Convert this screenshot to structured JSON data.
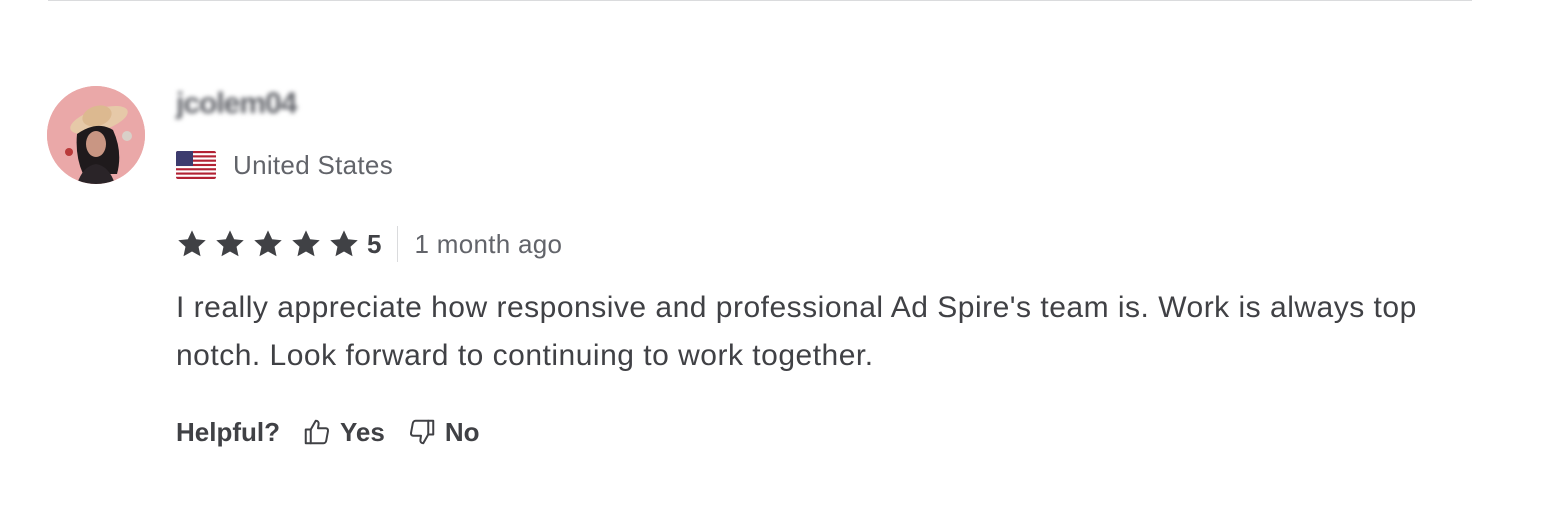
{
  "review": {
    "username": "jcolem04",
    "country": "United States",
    "country_flag_icon": "us-flag-icon",
    "rating": {
      "value": 5,
      "value_label": "5",
      "max": 5,
      "star_icon": "star-icon",
      "star_color": "#404145"
    },
    "time_ago": "1 month ago",
    "text": "I really appreciate how responsive and professional Ad Spire's team is. Work is always top notch. Look forward to continuing to work together.",
    "helpful": {
      "label": "Helpful?",
      "yes_label": "Yes",
      "yes_icon": "thumbs-up-icon",
      "no_label": "No",
      "no_icon": "thumbs-down-icon"
    }
  },
  "colors": {
    "avatar_bg": "#eaa8a8",
    "text_primary": "#404145",
    "text_secondary": "#62646a",
    "divider": "#dadbdd"
  }
}
